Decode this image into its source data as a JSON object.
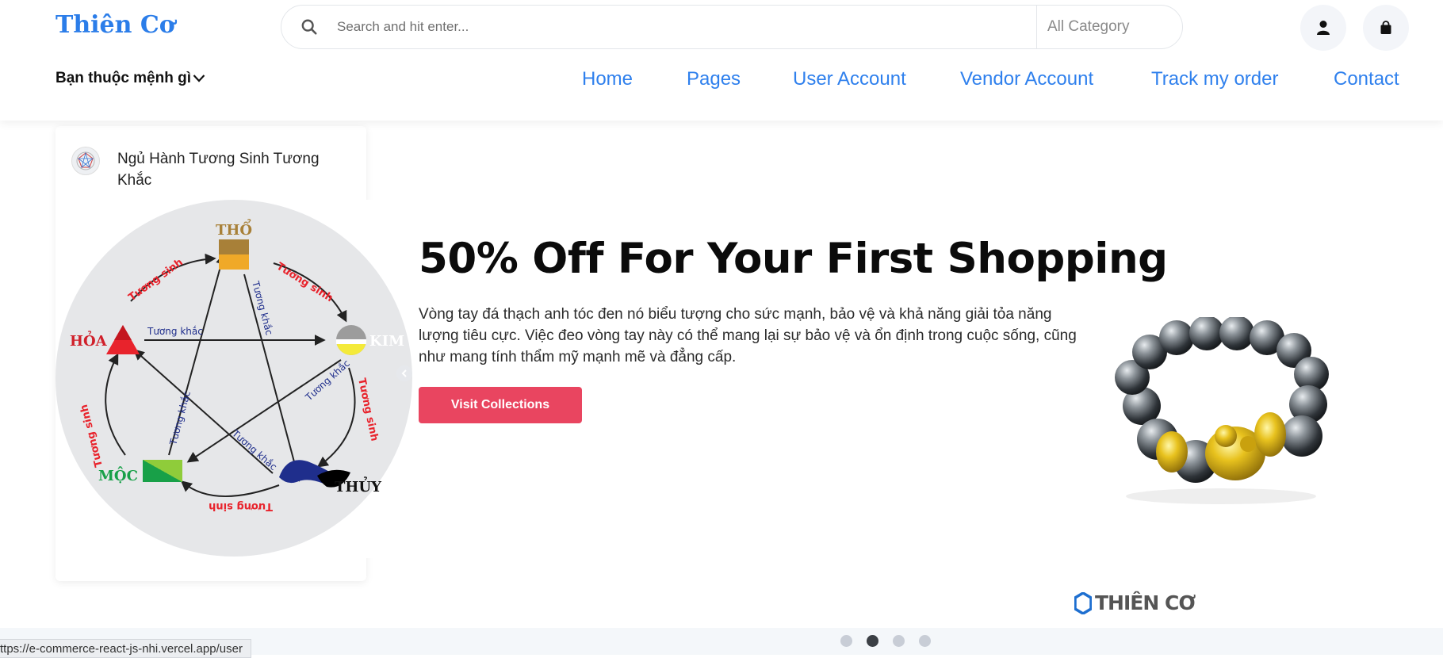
{
  "header": {
    "logo": "Thiên Cơ",
    "search": {
      "placeholder": "Search and hit enter...",
      "category": "All Category"
    },
    "menu_label": "Bạn thuộc mệnh gì",
    "nav": [
      "Home",
      "Pages",
      "User Account",
      "Vendor Account",
      "Track my order",
      "Contact"
    ]
  },
  "sidebar": {
    "items": [
      {
        "label": "Ngủ Hành Tương Sinh Tương Khắc"
      }
    ]
  },
  "wheel": {
    "elements": {
      "tho": "THỔ",
      "kim": "KIM",
      "thuy": "THỦY",
      "moc": "MỘC",
      "hoa": "HỎA"
    },
    "generate_label": "Tương sinh",
    "control_label": "Tương khắc"
  },
  "hero": {
    "title": "50% Off For Your First Shopping",
    "description": "Vòng tay đá thạch anh tóc đen nó biểu tượng cho sức mạnh, bảo vệ và khả năng giải tỏa năng lượng tiêu cực. Việc đeo vòng tay này có thể mang lại sự bảo vệ và ổn định trong cuộc sống, cũng như mang tính thẩm mỹ mạnh mẽ và đẳng cấp.",
    "cta": "Visit Collections",
    "brand_mark": "THIÊN CƠ"
  },
  "carousel": {
    "slides": 4,
    "active_index": 1
  },
  "status_url": "ttps://e-commerce-react-js-nhi.vercel.app/user",
  "colors": {
    "accent": "#2f80ed",
    "cta": "#e94560",
    "logo": "#2b7de9"
  }
}
